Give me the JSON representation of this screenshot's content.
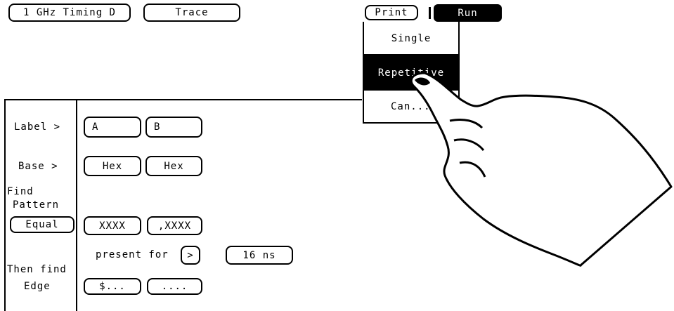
{
  "top_bar": {
    "module_label": "1 GHz Timing D",
    "menu_label": "Trace",
    "print_label": "Print",
    "run_label": "Run"
  },
  "run_menu": {
    "items": [
      "Single",
      "Repetitive",
      "Can..."
    ]
  },
  "left_panel": {
    "label": "Label >",
    "base": "Base >",
    "find_line1": "Find",
    "find_line2": "Pattern",
    "equal": "Equal",
    "then_find": "Then find",
    "edge": "Edge"
  },
  "fields": {
    "label_a": "A",
    "label_b": "B",
    "base_a": "Hex",
    "base_b": "Hex",
    "pattern_a": "XXXX",
    "pattern_b": ",XXXX",
    "present_for": "present for",
    "operator": ">",
    "duration": "16 ns",
    "edge_a": "$...",
    "edge_b": "...."
  }
}
